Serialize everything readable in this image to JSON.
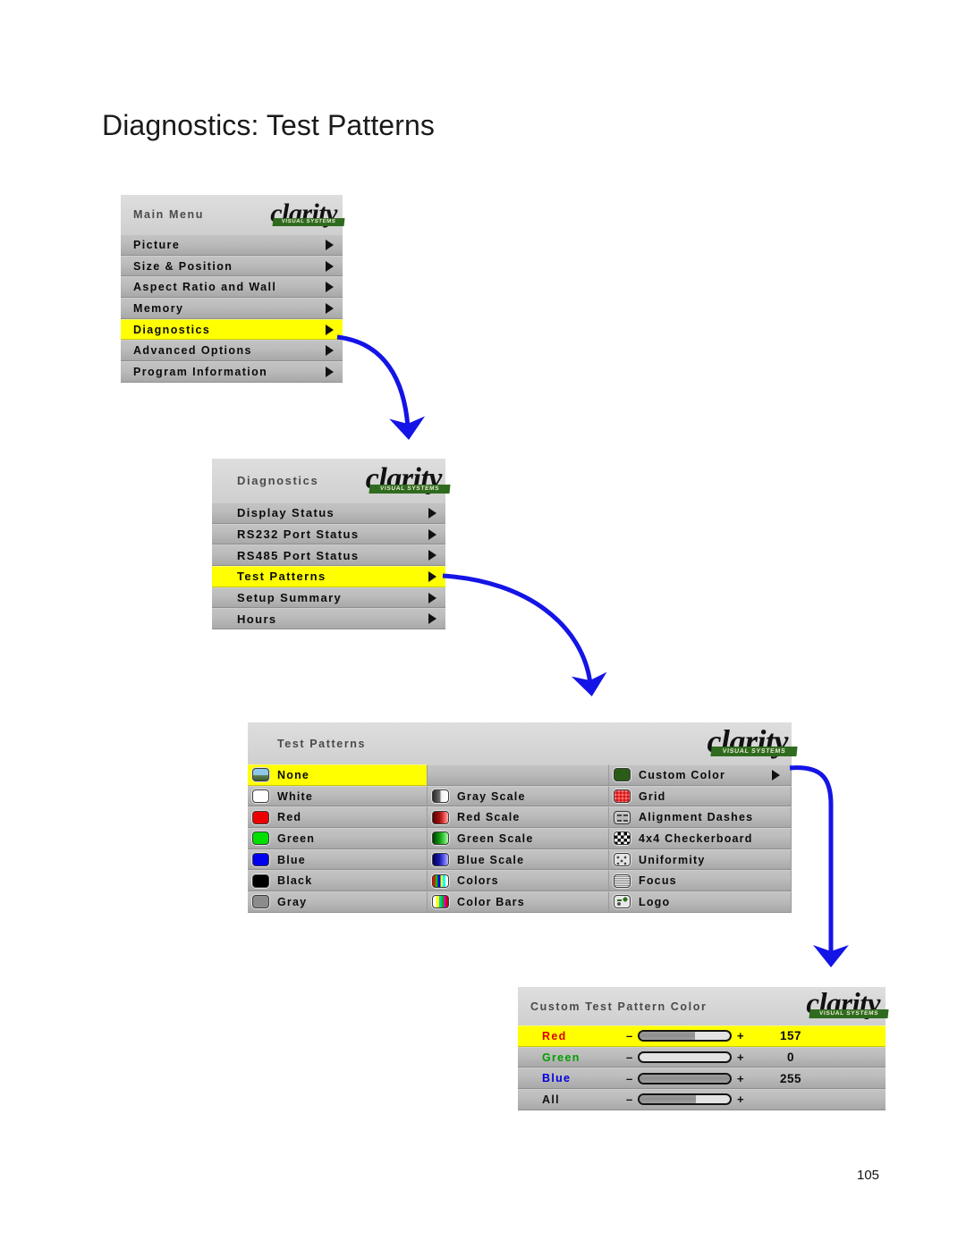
{
  "page": {
    "title": "Diagnostics: Test Patterns",
    "number": "105",
    "accent_highlight": "#ffff00",
    "arrow_color": "#1414e6",
    "panel_bg": "#b4b4b4",
    "logo_green": "#2f6b1e"
  },
  "logo": {
    "word": "clarity",
    "tagline": "VISUAL SYSTEMS"
  },
  "main_menu": {
    "title": "Main Menu",
    "items": [
      {
        "label": "Picture",
        "has_submenu": true,
        "highlighted": false
      },
      {
        "label": "Size & Position",
        "has_submenu": true,
        "highlighted": false
      },
      {
        "label": "Aspect Ratio and Wall",
        "has_submenu": true,
        "highlighted": false
      },
      {
        "label": "Memory",
        "has_submenu": true,
        "highlighted": false
      },
      {
        "label": "Diagnostics",
        "has_submenu": true,
        "highlighted": true
      },
      {
        "label": "Advanced Options",
        "has_submenu": true,
        "highlighted": false
      },
      {
        "label": "Program Information",
        "has_submenu": true,
        "highlighted": false
      }
    ]
  },
  "diagnostics_menu": {
    "title": "Diagnostics",
    "items": [
      {
        "label": "Display Status",
        "has_submenu": true,
        "highlighted": false
      },
      {
        "label": "RS232 Port Status",
        "has_submenu": true,
        "highlighted": false
      },
      {
        "label": "RS485 Port Status",
        "has_submenu": true,
        "highlighted": false
      },
      {
        "label": "Test Patterns",
        "has_submenu": true,
        "highlighted": true
      },
      {
        "label": "Setup Summary",
        "has_submenu": true,
        "highlighted": false
      },
      {
        "label": "Hours",
        "has_submenu": true,
        "highlighted": false
      }
    ]
  },
  "test_patterns_menu": {
    "title": "Test Patterns",
    "columns": [
      [
        {
          "label": "None",
          "icon": "pattern-none-icon",
          "swatch": "none",
          "highlighted": true,
          "has_submenu": false
        },
        {
          "label": "White",
          "icon": "pattern-white-icon",
          "swatch": "white",
          "highlighted": false,
          "has_submenu": false
        },
        {
          "label": "Red",
          "icon": "pattern-red-icon",
          "swatch": "red",
          "highlighted": false,
          "has_submenu": false
        },
        {
          "label": "Green",
          "icon": "pattern-green-icon",
          "swatch": "green",
          "highlighted": false,
          "has_submenu": false
        },
        {
          "label": "Blue",
          "icon": "pattern-blue-icon",
          "swatch": "blue",
          "highlighted": false,
          "has_submenu": false
        },
        {
          "label": "Black",
          "icon": "pattern-black-icon",
          "swatch": "black",
          "highlighted": false,
          "has_submenu": false
        },
        {
          "label": "Gray",
          "icon": "pattern-gray-icon",
          "swatch": "gray",
          "highlighted": false,
          "has_submenu": false
        }
      ],
      [
        {
          "label": "",
          "icon": "",
          "swatch": "empty",
          "highlighted": false,
          "has_submenu": false
        },
        {
          "label": "Gray Scale",
          "icon": "pattern-gray-scale-icon",
          "swatch": "grayscale",
          "highlighted": false,
          "has_submenu": false
        },
        {
          "label": "Red Scale",
          "icon": "pattern-red-scale-icon",
          "swatch": "redscale",
          "highlighted": false,
          "has_submenu": false
        },
        {
          "label": "Green Scale",
          "icon": "pattern-green-scale-icon",
          "swatch": "greenscale",
          "highlighted": false,
          "has_submenu": false
        },
        {
          "label": "Blue Scale",
          "icon": "pattern-blue-scale-icon",
          "swatch": "bluescale",
          "highlighted": false,
          "has_submenu": false
        },
        {
          "label": "Colors",
          "icon": "pattern-colors-icon",
          "swatch": "colors",
          "highlighted": false,
          "has_submenu": false
        },
        {
          "label": "Color Bars",
          "icon": "pattern-color-bars-icon",
          "swatch": "colorbars",
          "highlighted": false,
          "has_submenu": false
        }
      ],
      [
        {
          "label": "Custom Color",
          "icon": "pattern-custom-color-icon",
          "swatch": "custom",
          "highlighted": false,
          "has_submenu": true
        },
        {
          "label": "Grid",
          "icon": "pattern-grid-icon",
          "swatch": "grid",
          "highlighted": false,
          "has_submenu": false
        },
        {
          "label": "Alignment Dashes",
          "icon": "pattern-alignment-dashes-icon",
          "swatch": "dashes",
          "highlighted": false,
          "has_submenu": false
        },
        {
          "label": "4x4 Checkerboard",
          "icon": "pattern-checkerboard-icon",
          "swatch": "checker",
          "highlighted": false,
          "has_submenu": false
        },
        {
          "label": "Uniformity",
          "icon": "pattern-uniformity-icon",
          "swatch": "uniformity",
          "highlighted": false,
          "has_submenu": false
        },
        {
          "label": "Focus",
          "icon": "pattern-focus-icon",
          "swatch": "focus",
          "highlighted": false,
          "has_submenu": false
        },
        {
          "label": "Logo",
          "icon": "pattern-logo-icon",
          "swatch": "logo",
          "highlighted": false,
          "has_submenu": false
        }
      ]
    ]
  },
  "custom_color_menu": {
    "title": "Custom Test Pattern Color",
    "decrement_label": "–",
    "increment_label": "+",
    "rows": [
      {
        "label": "Red",
        "label_color": "#dd0000",
        "value": "157",
        "percent": 61,
        "highlighted": true
      },
      {
        "label": "Green",
        "label_color": "#00a000",
        "value": "0",
        "percent": 0,
        "highlighted": false
      },
      {
        "label": "Blue",
        "label_color": "#0000dd",
        "value": "255",
        "percent": 100,
        "highlighted": false
      },
      {
        "label": "All",
        "label_color": "#111111",
        "value": "",
        "percent": 62,
        "highlighted": false
      }
    ]
  }
}
